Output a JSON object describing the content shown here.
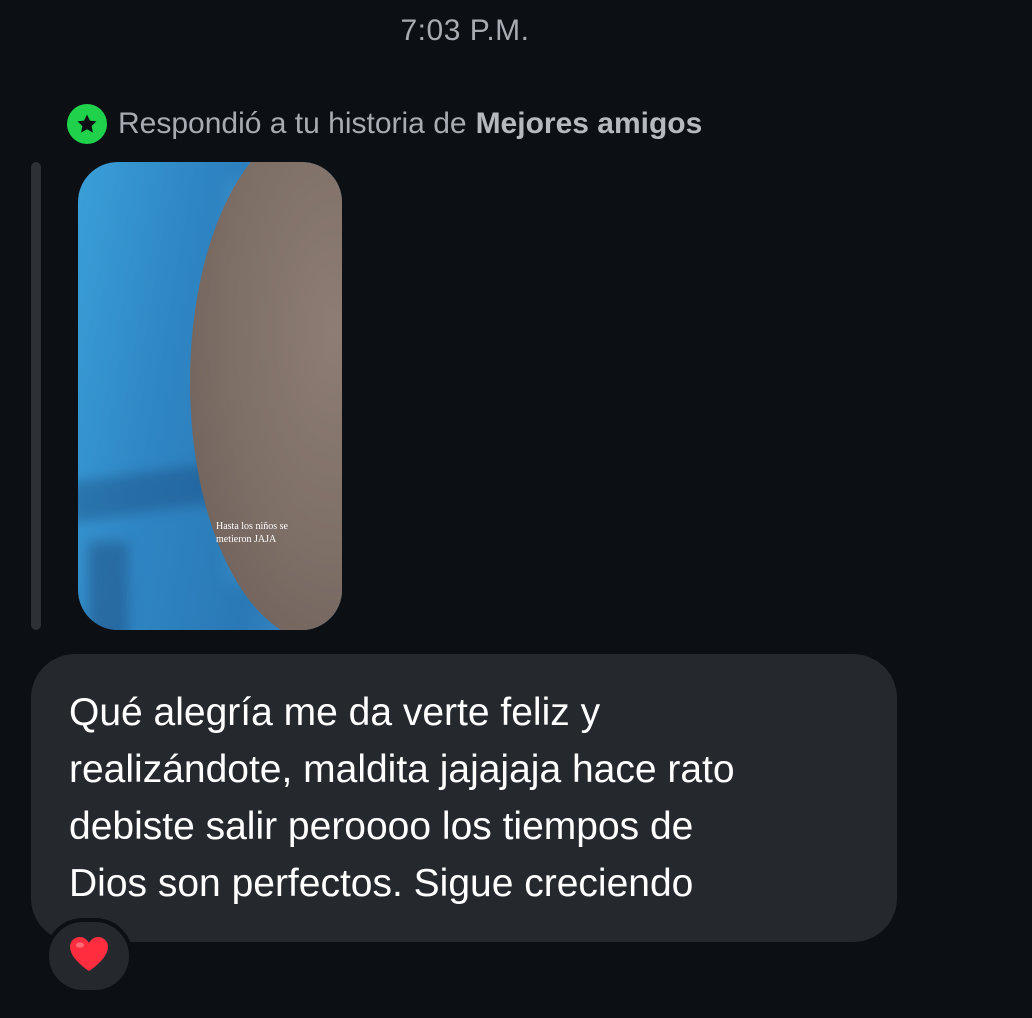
{
  "timestamp": "7:03 P.M.",
  "reply_header": {
    "icon": "star-icon",
    "text": "Respondió a tu historia de",
    "list_name": "Mejores amigos",
    "badge_color": "#1fd14b"
  },
  "story": {
    "caption_line1": "Hasta los niños se",
    "caption_line2": "metieron JAJA"
  },
  "message": {
    "line1": "Qué alegría me da verte feliz y",
    "line2": "realizándote, maldita jajajaja hace rato",
    "line3": "debiste salir peroooo los tiempos de",
    "line4": "Dios son perfectos. Sigue creciendo"
  },
  "reaction": {
    "icon": "heart-icon",
    "color": "#ff2d3d"
  }
}
